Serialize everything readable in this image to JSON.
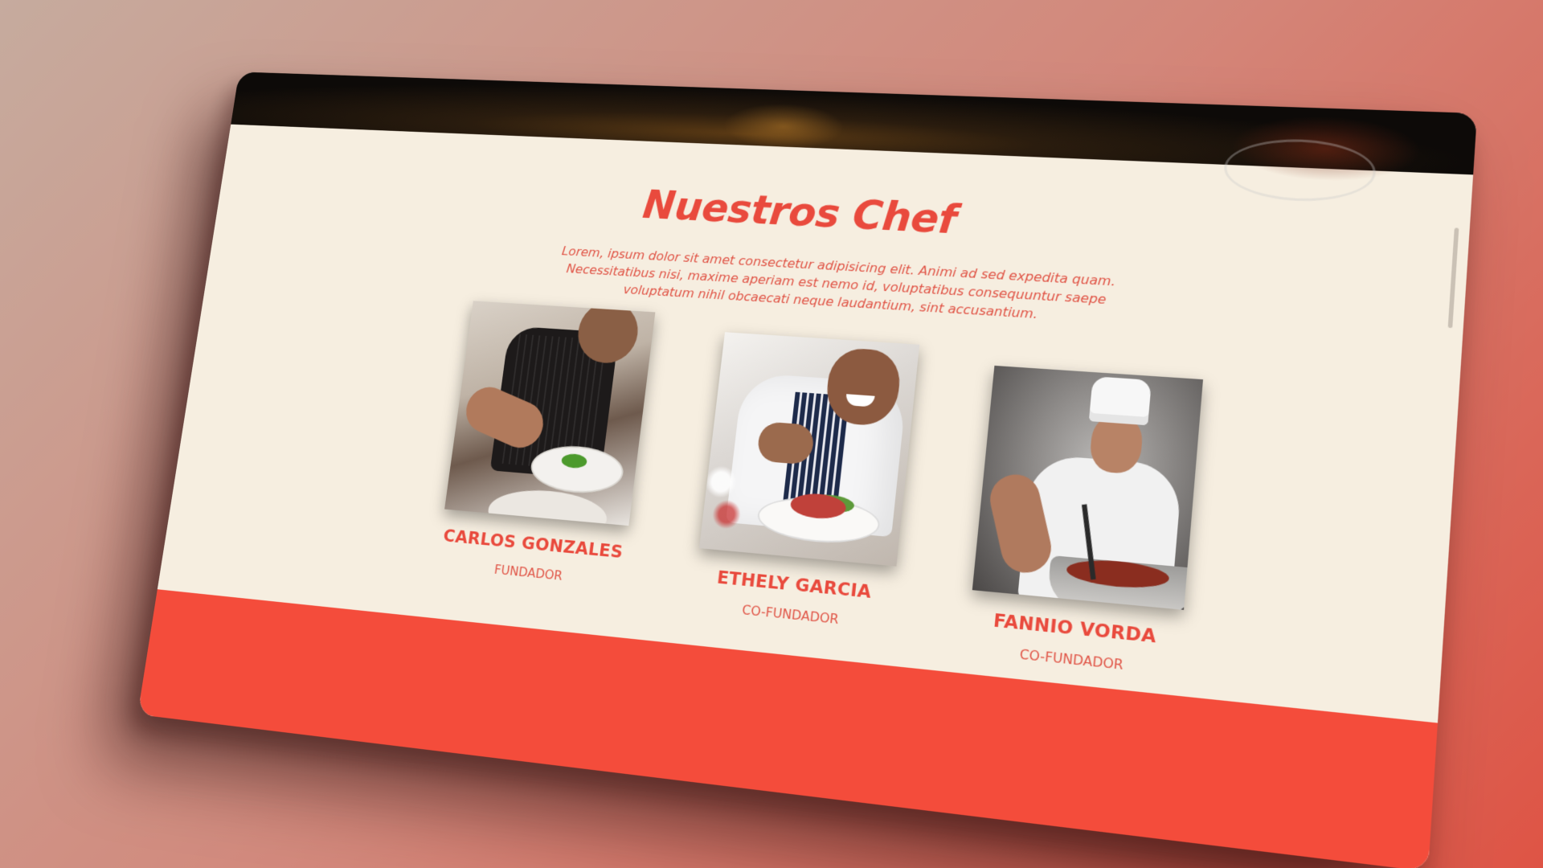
{
  "section": {
    "title": "Nuestros Chef",
    "description": "Lorem, ipsum dolor sit amet consectetur adipisicing elit. Animi ad sed expedita quam. Necessitatibus nisi, maxime aperiam est nemo id, voluptatibus consequuntur saepe voluptatum nihil obcaecati neque laudantium, sint accusantium."
  },
  "chefs": [
    {
      "name": "CARLOS GONZALES",
      "role": "FUNDADOR",
      "photo_icon": "chef-plating-photo"
    },
    {
      "name": "ETHELY GARCIA",
      "role": "CO-FUNDADOR",
      "photo_icon": "chef-smiling-photo"
    },
    {
      "name": "FANNIO VORDA",
      "role": "CO-FUNDADOR",
      "photo_icon": "chef-hat-cooking-photo"
    }
  ],
  "colors": {
    "accent": "#e94a3d",
    "section_background": "#f6eee0",
    "footer_band": "#f44c3b",
    "hero_dark": "#0d0a08"
  }
}
